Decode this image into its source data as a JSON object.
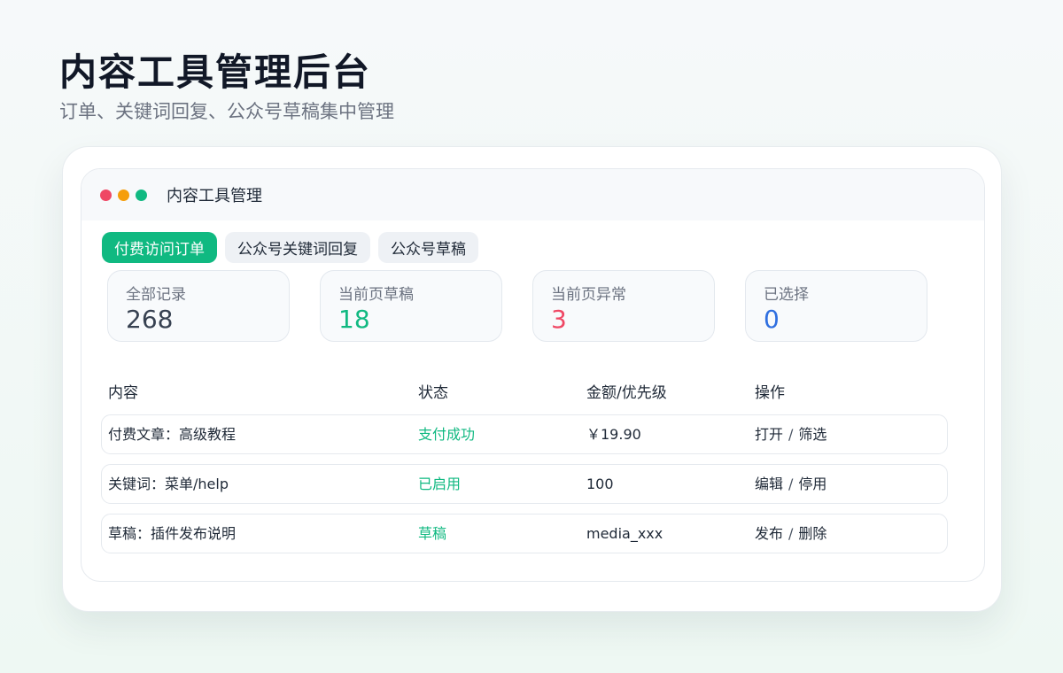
{
  "hero": {
    "title": "内容工具管理后台",
    "subtitle": "订单、关键词回复、公众号草稿集中管理"
  },
  "window": {
    "title": "内容工具管理"
  },
  "tabs": [
    {
      "label": "付费访问订单",
      "active": true
    },
    {
      "label": "公众号关键词回复",
      "active": false
    },
    {
      "label": "公众号草稿",
      "active": false
    }
  ],
  "stats": [
    {
      "label": "全部记录",
      "value": "268",
      "color": "#374151"
    },
    {
      "label": "当前页草稿",
      "value": "18",
      "color": "#10b981"
    },
    {
      "label": "当前页异常",
      "value": "3",
      "color": "#ef4764"
    },
    {
      "label": "已选择",
      "value": "0",
      "color": "#2f6fe0"
    }
  ],
  "table": {
    "headers": [
      "内容",
      "状态",
      "金额/优先级",
      "操作"
    ],
    "rows": [
      {
        "content": "付费文章：高级教程",
        "status": "支付成功",
        "amount": "￥19.90",
        "action1": "打开",
        "action2": "筛选"
      },
      {
        "content": "关键词：菜单/help",
        "status": "已启用",
        "amount": "100",
        "action1": "编辑",
        "action2": "停用"
      },
      {
        "content": "草稿：插件发布说明",
        "status": "草稿",
        "amount": "media_xxx",
        "action1": "发布",
        "action2": "删除"
      }
    ],
    "action_separator": "/"
  },
  "colors": {
    "accent": "#10b981",
    "danger": "#ef4764",
    "warning": "#f59e0b",
    "info": "#2f6fe0"
  }
}
